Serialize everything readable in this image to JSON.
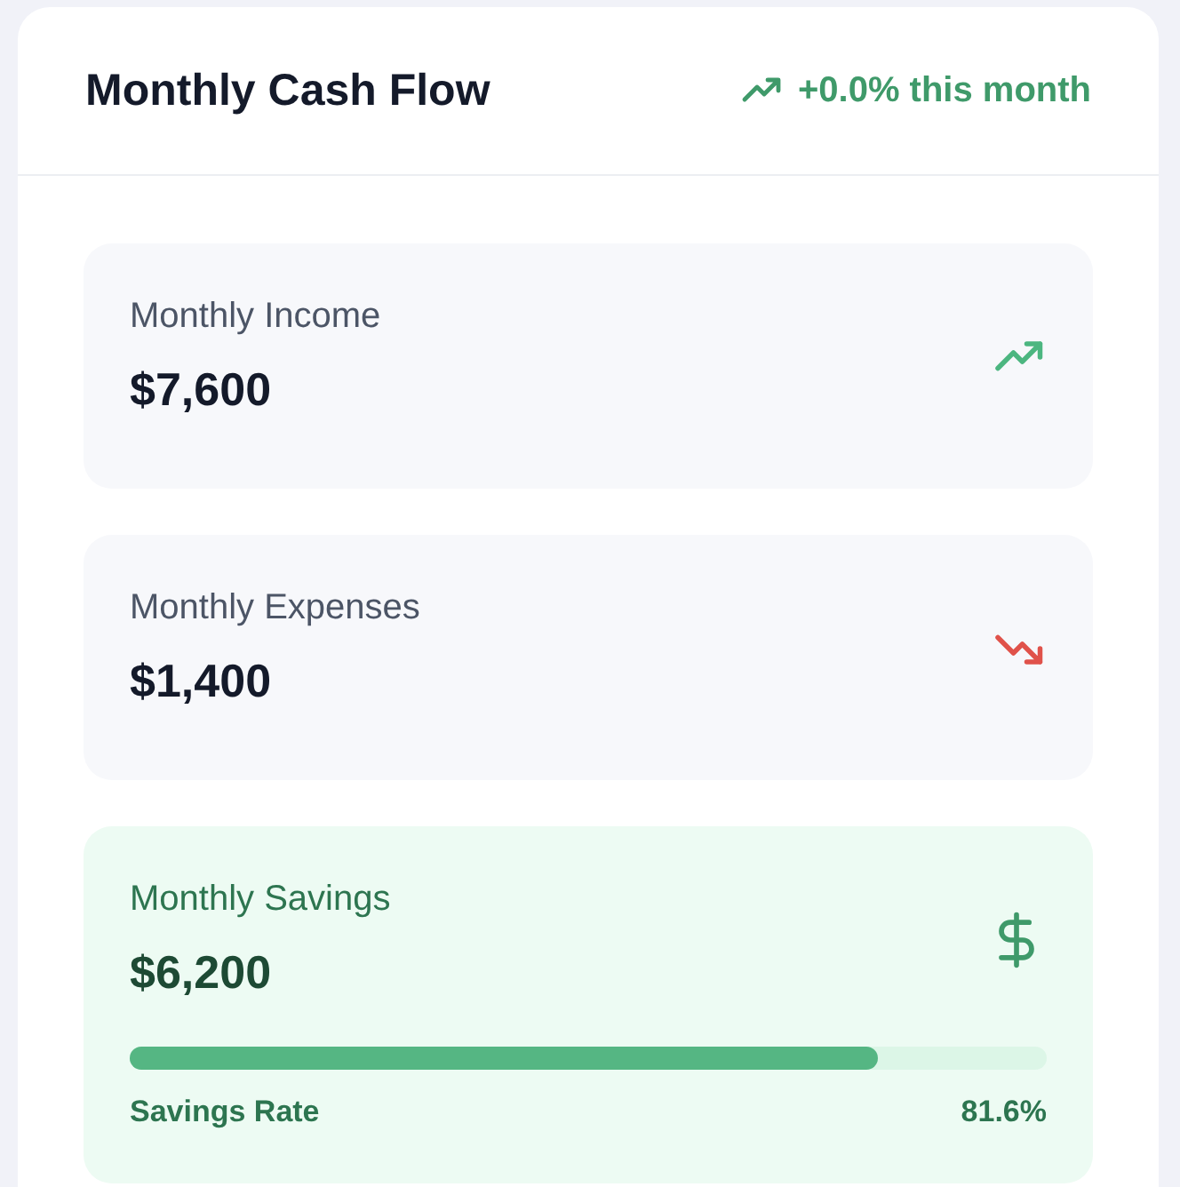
{
  "header": {
    "title": "Monthly Cash Flow",
    "trend": {
      "kind": "up",
      "text": "+0.0% this month"
    }
  },
  "cards": [
    {
      "kind": "income",
      "label": "Monthly Income",
      "amount": "$7,600"
    },
    {
      "kind": "expenses",
      "label": "Monthly Expenses",
      "amount": "$1,400"
    },
    {
      "kind": "savings",
      "label": "Monthly Savings",
      "amount": "$6,200",
      "progress": {
        "label": "Savings Rate",
        "level": 0.816,
        "reading": "81.6%"
      }
    }
  ]
}
